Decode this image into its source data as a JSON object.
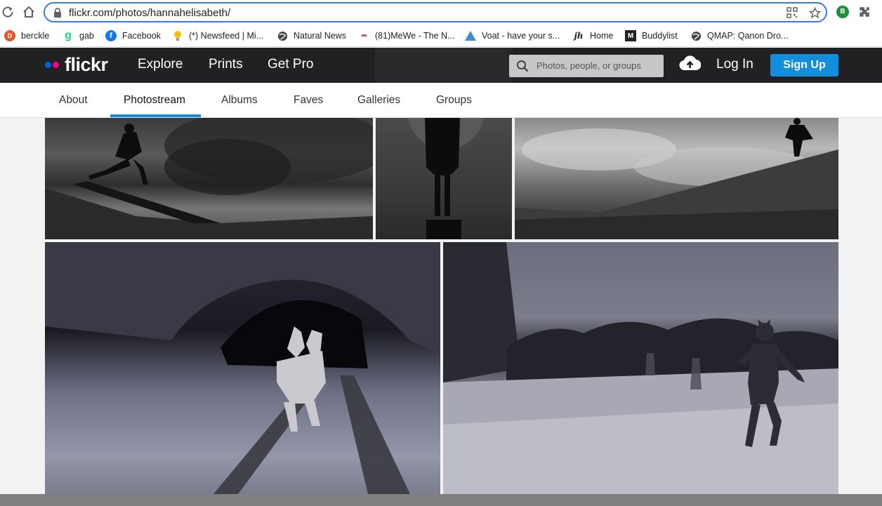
{
  "browser": {
    "url": "flickr.com/photos/hannahelisabeth/",
    "profile_initial": "B",
    "bookmarks": [
      {
        "label": "berckle",
        "icon": "duckduckgo-icon"
      },
      {
        "label": "gab",
        "icon": "gab-icon"
      },
      {
        "label": "Facebook",
        "icon": "facebook-icon"
      },
      {
        "label": "(*) Newsfeed | Mi...",
        "icon": "lightbulb-icon"
      },
      {
        "label": "Natural News",
        "icon": "globe-icon"
      },
      {
        "label": "(81)MeWe - The N...",
        "icon": "mewe-icon"
      },
      {
        "label": "Voat - have your s...",
        "icon": "voat-icon"
      },
      {
        "label": "Home",
        "icon": "jh-icon"
      },
      {
        "label": "Buddylist",
        "icon": "buddylist-icon"
      },
      {
        "label": "QMAP: Qanon Dro...",
        "icon": "globe-icon"
      }
    ],
    "more_label": "»"
  },
  "header": {
    "logo": "flickr",
    "nav": [
      "Explore",
      "Prints",
      "Get Pro"
    ],
    "search_placeholder": "Photos, people, or groups",
    "login": "Log In",
    "signup": "Sign Up",
    "colors": {
      "dot_blue": "#0063dc",
      "dot_pink": "#ff0084",
      "signup": "#128fdc"
    }
  },
  "subnav": {
    "tabs": [
      "About",
      "Photostream",
      "Albums",
      "Faves",
      "Galleries",
      "Groups"
    ],
    "active": "Photostream"
  },
  "photos": [
    {
      "name": "photo-silhouette-jumping-smoke"
    },
    {
      "name": "photo-silhouette-standing"
    },
    {
      "name": "photo-figure-on-wall-clouds"
    },
    {
      "name": "photo-masked-figure-tunnel-tracks"
    },
    {
      "name": "photo-masked-figure-running-field"
    }
  ]
}
